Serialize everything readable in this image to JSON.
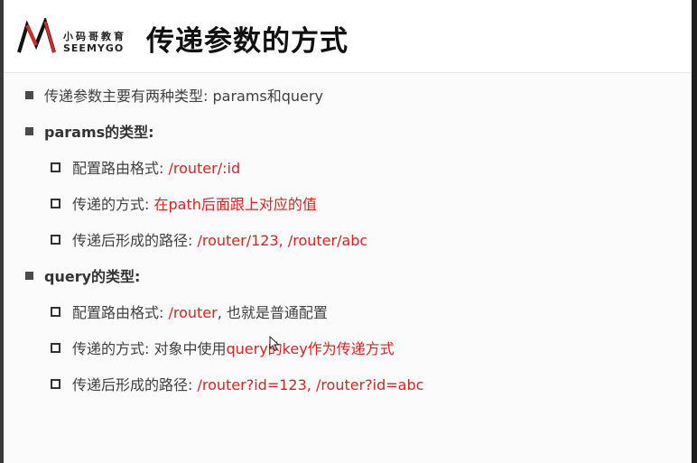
{
  "header": {
    "logo": {
      "cn": "小码哥教育",
      "en": "SEEMYGO"
    },
    "title": "传递参数的方式"
  },
  "intro": "传递参数主要有两种类型: params和query",
  "sections": [
    {
      "heading": "params的类型:",
      "items": [
        {
          "label": "配置路由格式: ",
          "value": "/router/:id",
          "value_suffix": ""
        },
        {
          "label": "传递的方式: ",
          "value": "在path后面跟上对应的值",
          "value_suffix": ""
        },
        {
          "label": "传递后形成的路径: ",
          "value": "/router/123, /router/abc",
          "value_suffix": ""
        }
      ]
    },
    {
      "heading": "query的类型:",
      "items": [
        {
          "label": "配置路由格式: ",
          "value": "/router",
          "value_suffix": ", 也就是普通配置"
        },
        {
          "label": "传递的方式: 对象中使用",
          "value": "query的key作为传递方式",
          "value_suffix": ""
        },
        {
          "label": "传递后形成的路径: ",
          "value": "/router?id=123, /router?id=abc",
          "value_suffix": ""
        }
      ]
    }
  ],
  "colors": {
    "accent": "#e02020",
    "text": "#404040",
    "title": "#111111"
  }
}
